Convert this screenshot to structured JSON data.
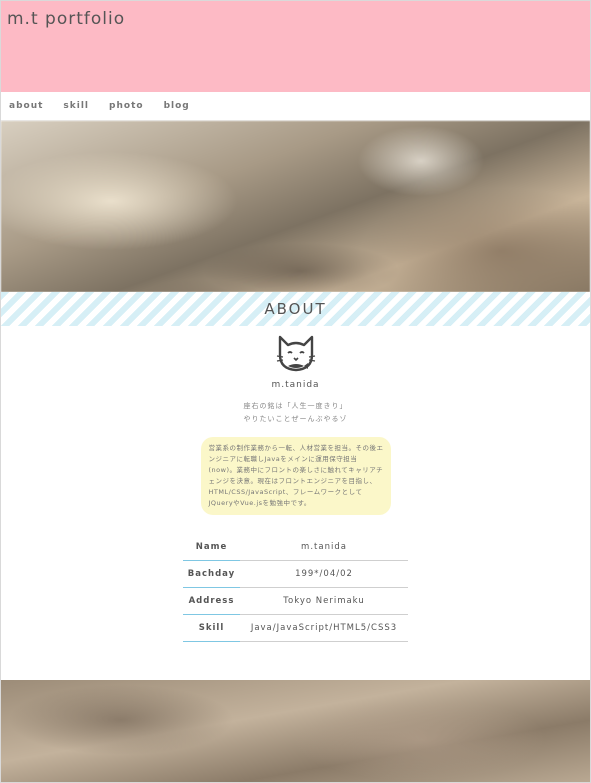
{
  "header": {
    "title": "m.t portfolio",
    "background": "#fdbac5"
  },
  "nav": {
    "items": [
      "about",
      "skill",
      "photo",
      "blog"
    ]
  },
  "about": {
    "heading": "ABOUT",
    "icon": "cat-face-icon",
    "name": "m.tanida",
    "motto_line1": "座右の銘は「人生一度きり」",
    "motto_line2": "やりたいことぜーんぶやるゾ",
    "bio": "営業系の制作業務から一転、人材営業を担当。その後エンジニアに転職しJavaをメインに運用保守担当(now)。業務中にフロントの楽しさに触れてキャリアチェンジを決意。現在はフロントエンジニアを目指し、HTML/CSS/JavaScript、フレームワークとしてJQueryやVue.jsを勉強中です。"
  },
  "profile_table": [
    {
      "label": "Name",
      "value": "m.tanida"
    },
    {
      "label": "Bachday",
      "value": "199*/04/02"
    },
    {
      "label": "Address",
      "value": "Tokyo Nerimaku"
    },
    {
      "label": "Skill",
      "value": "Java/JavaScript/HTML5/CSS3"
    }
  ],
  "colors": {
    "stripe": "#d6eff6",
    "bio_bg": "#fbf7c9",
    "table_accent": "#7fc7e3"
  }
}
